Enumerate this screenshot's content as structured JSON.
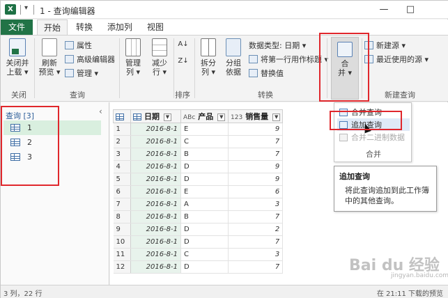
{
  "window": {
    "title": "1 - 查询编辑器",
    "logo": "X",
    "qat_dropdown": "▾",
    "minimize": "—",
    "restore": "□"
  },
  "tabs": [
    {
      "label": "文件"
    },
    {
      "label": "开始"
    },
    {
      "label": "转换"
    },
    {
      "label": "添加列"
    },
    {
      "label": "视图"
    }
  ],
  "ribbon": {
    "close_apply": {
      "line1": "关闭并",
      "line2": "上载 ▾"
    },
    "refresh": {
      "line1": "刷新",
      "line2": "预览 ▾"
    },
    "properties": "属性",
    "advanced_editor": "高级编辑器",
    "manage": "管理 ▾",
    "manage_cols": {
      "line1": "管理",
      "line2": "列 ▾"
    },
    "reduce_rows": {
      "line1": "减少",
      "line2": "行 ▾"
    },
    "sort_asc": "A↓",
    "sort_desc": "Z↓",
    "split_col": {
      "line1": "拆分",
      "line2": "列 ▾"
    },
    "group_by": {
      "line1": "分组",
      "line2": "依据"
    },
    "data_type": "数据类型: 日期 ▾",
    "first_row_header": "将第一行用作标题 ▾",
    "replace_values": "替换值",
    "combine": {
      "line1": "合",
      "line2": "并 ▾"
    },
    "new_source": "新建源 ▾",
    "recent_sources": "最近使用的源 ▾",
    "groups": {
      "close": "关闭",
      "query": "查询",
      "sort": "排序",
      "transform": "转换",
      "new_query": "新建查询"
    }
  },
  "left_panel": {
    "header": "查询 [3]",
    "collapse": "‹",
    "items": [
      {
        "label": "1"
      },
      {
        "label": "2"
      },
      {
        "label": "3"
      }
    ]
  },
  "grid": {
    "col_date": {
      "type": "",
      "label": "日期"
    },
    "col_product": {
      "type": "ABc",
      "label": "产品"
    },
    "col_sales": {
      "type": "123",
      "label": "销售量"
    },
    "rows": [
      {
        "n": "1",
        "date": "2016-8-1",
        "product": "E",
        "sales": "9"
      },
      {
        "n": "2",
        "date": "2016-8-1",
        "product": "C",
        "sales": "7"
      },
      {
        "n": "3",
        "date": "2016-8-1",
        "product": "B",
        "sales": "7"
      },
      {
        "n": "4",
        "date": "2016-8-1",
        "product": "D",
        "sales": "9"
      },
      {
        "n": "5",
        "date": "2016-8-1",
        "product": "D",
        "sales": "9"
      },
      {
        "n": "6",
        "date": "2016-8-1",
        "product": "E",
        "sales": "6"
      },
      {
        "n": "7",
        "date": "2016-8-1",
        "product": "A",
        "sales": "3"
      },
      {
        "n": "8",
        "date": "2016-8-1",
        "product": "B",
        "sales": "7"
      },
      {
        "n": "9",
        "date": "2016-8-1",
        "product": "D",
        "sales": "2"
      },
      {
        "n": "10",
        "date": "2016-8-1",
        "product": "D",
        "sales": "7"
      },
      {
        "n": "11",
        "date": "2016-8-1",
        "product": "C",
        "sales": "3"
      },
      {
        "n": "12",
        "date": "2016-8-1",
        "product": "D",
        "sales": "7"
      }
    ]
  },
  "combine_menu": {
    "merge": "合并查询",
    "append": "追加查询",
    "combine_binary": "合并二进制数据",
    "group_label": "合并"
  },
  "tooltip": {
    "title": "追加查询",
    "desc": "将此查询追加到此工作簿中的其他查询。"
  },
  "status": {
    "left": "3 列，22 行",
    "right": "在 21:11 下载的预览"
  },
  "watermark": {
    "brand": "Bai du 经验",
    "sub": "jingyan.baidu.com"
  },
  "colors": {
    "excel_green": "#217346",
    "annotation_red": "#e0272c",
    "selection_green": "#d9efdf"
  },
  "icons": [
    "excel-logo-icon",
    "table-icon",
    "refresh-icon",
    "properties-icon",
    "sort-icon",
    "merge-icon",
    "append-icon",
    "cursor-icon"
  ]
}
